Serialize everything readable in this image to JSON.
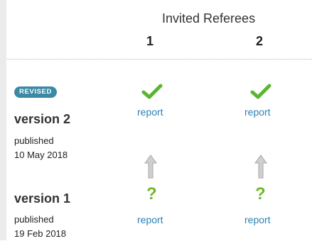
{
  "header": {
    "title": "Invited Referees",
    "columns": [
      "1",
      "2"
    ]
  },
  "versions": [
    {
      "badge": "REVISED",
      "title": "version 2",
      "published_label": "published",
      "date": "10 May 2018",
      "reports": [
        {
          "status_icon": "check-icon",
          "link": "report"
        },
        {
          "status_icon": "check-icon",
          "link": "report"
        }
      ]
    },
    {
      "title": "version 1",
      "published_label": "published",
      "date": "19 Feb 2018",
      "reports": [
        {
          "status_icon": "question-mark-icon",
          "glyph": "?",
          "link": "report"
        },
        {
          "status_icon": "question-mark-icon",
          "glyph": "?",
          "link": "report"
        }
      ]
    }
  ],
  "colors": {
    "approved": "#5cb531",
    "pending": "#6fb728",
    "link": "#2b82b3",
    "badge": "#3a8aa6",
    "arrow": "#b0b0b0"
  }
}
